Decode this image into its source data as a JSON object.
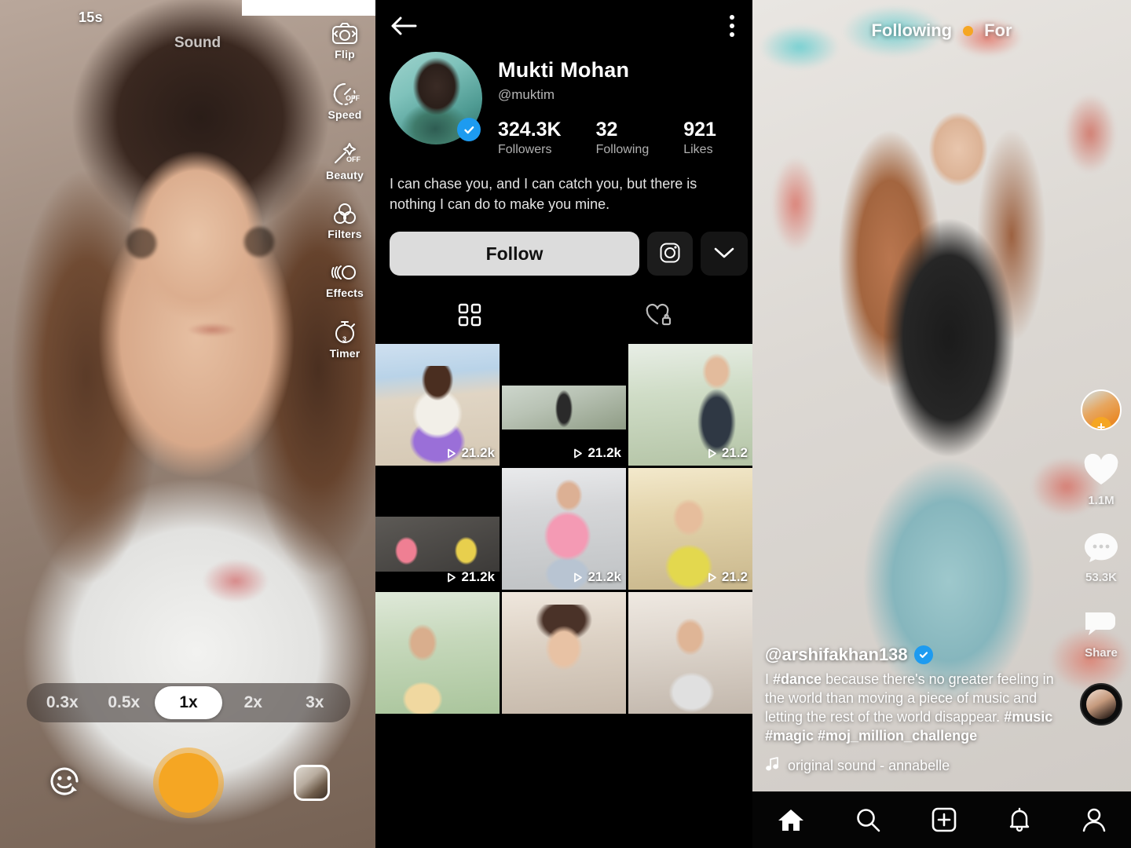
{
  "panel_camera": {
    "duration_badge": "15s",
    "sound_label": "Sound",
    "rail": [
      {
        "label": "Flip",
        "icon": "camera-flip-icon"
      },
      {
        "label": "Speed",
        "icon": "speedometer-icon",
        "badge": "OFF"
      },
      {
        "label": "Beauty",
        "icon": "magic-wand-icon",
        "badge": "OFF"
      },
      {
        "label": "Filters",
        "icon": "filters-icon"
      },
      {
        "label": "Effects",
        "icon": "effects-icon"
      },
      {
        "label": "Timer",
        "icon": "timer-icon",
        "badge": "3"
      }
    ],
    "speeds": [
      "0.3x",
      "0.5x",
      "1x",
      "2x",
      "3x"
    ],
    "selected_speed": "1x",
    "shutter_color": "#f5a623",
    "effects_button": "smiley-effects-icon",
    "gallery_button": "gallery-thumbnail-icon"
  },
  "panel_profile": {
    "back_icon": "back-arrow-icon",
    "more_icon": "more-vertical-icon",
    "name": "Mukti Mohan",
    "handle": "@muktim",
    "verified": true,
    "stats": [
      {
        "value": "324.3K",
        "label": "Followers"
      },
      {
        "value": "32",
        "label": "Following"
      },
      {
        "value": "921",
        "label": "Likes"
      }
    ],
    "bio": "I can chase you, and I can catch you, but there is nothing I can do to make you mine.",
    "follow_label": "Follow",
    "instagram_icon": "instagram-icon",
    "expand_icon": "chevron-down-icon",
    "tabs": [
      {
        "icon": "grid-icon",
        "active": true
      },
      {
        "icon": "heart-lock-icon",
        "active": false
      }
    ],
    "videos": [
      {
        "plays": "21.2k"
      },
      {
        "plays": "21.2k"
      },
      {
        "plays": "21.2"
      },
      {
        "plays": "21.2k"
      },
      {
        "plays": "21.2k"
      },
      {
        "plays": "21.2"
      },
      {
        "plays": ""
      },
      {
        "plays": ""
      },
      {
        "plays": ""
      }
    ]
  },
  "panel_feed": {
    "tabs": [
      {
        "label": "Following",
        "active": true
      },
      {
        "label": "For",
        "active": false
      }
    ],
    "tab_dot_color": "#f5a623",
    "rail": [
      {
        "icon": "profile-avatar-follow-icon",
        "label": ""
      },
      {
        "icon": "heart-icon",
        "label": "1.1M"
      },
      {
        "icon": "comment-icon",
        "label": "53.3K"
      },
      {
        "icon": "share-icon",
        "label": "Share"
      },
      {
        "icon": "sound-disc-icon",
        "label": ""
      }
    ],
    "caption": {
      "username": "@arshifakhan138",
      "verified": true,
      "text_parts": [
        {
          "text": "I ",
          "bold": false
        },
        {
          "text": "#dance",
          "bold": true
        },
        {
          "text": " because there's no greater feeling in the world than moving a piece of music and letting the rest of the world disappear. ",
          "bold": false
        },
        {
          "text": "#music #magic #moj_million_challenge",
          "bold": true
        }
      ],
      "sound_icon": "music-note-icon",
      "sound_label": "original sound - annabelle"
    },
    "bottom_nav": [
      {
        "icon": "home-icon",
        "active": true
      },
      {
        "icon": "search-icon",
        "active": false
      },
      {
        "icon": "create-plus-icon",
        "active": false
      },
      {
        "icon": "notifications-bell-icon",
        "active": false
      },
      {
        "icon": "profile-person-icon",
        "active": false
      }
    ]
  }
}
